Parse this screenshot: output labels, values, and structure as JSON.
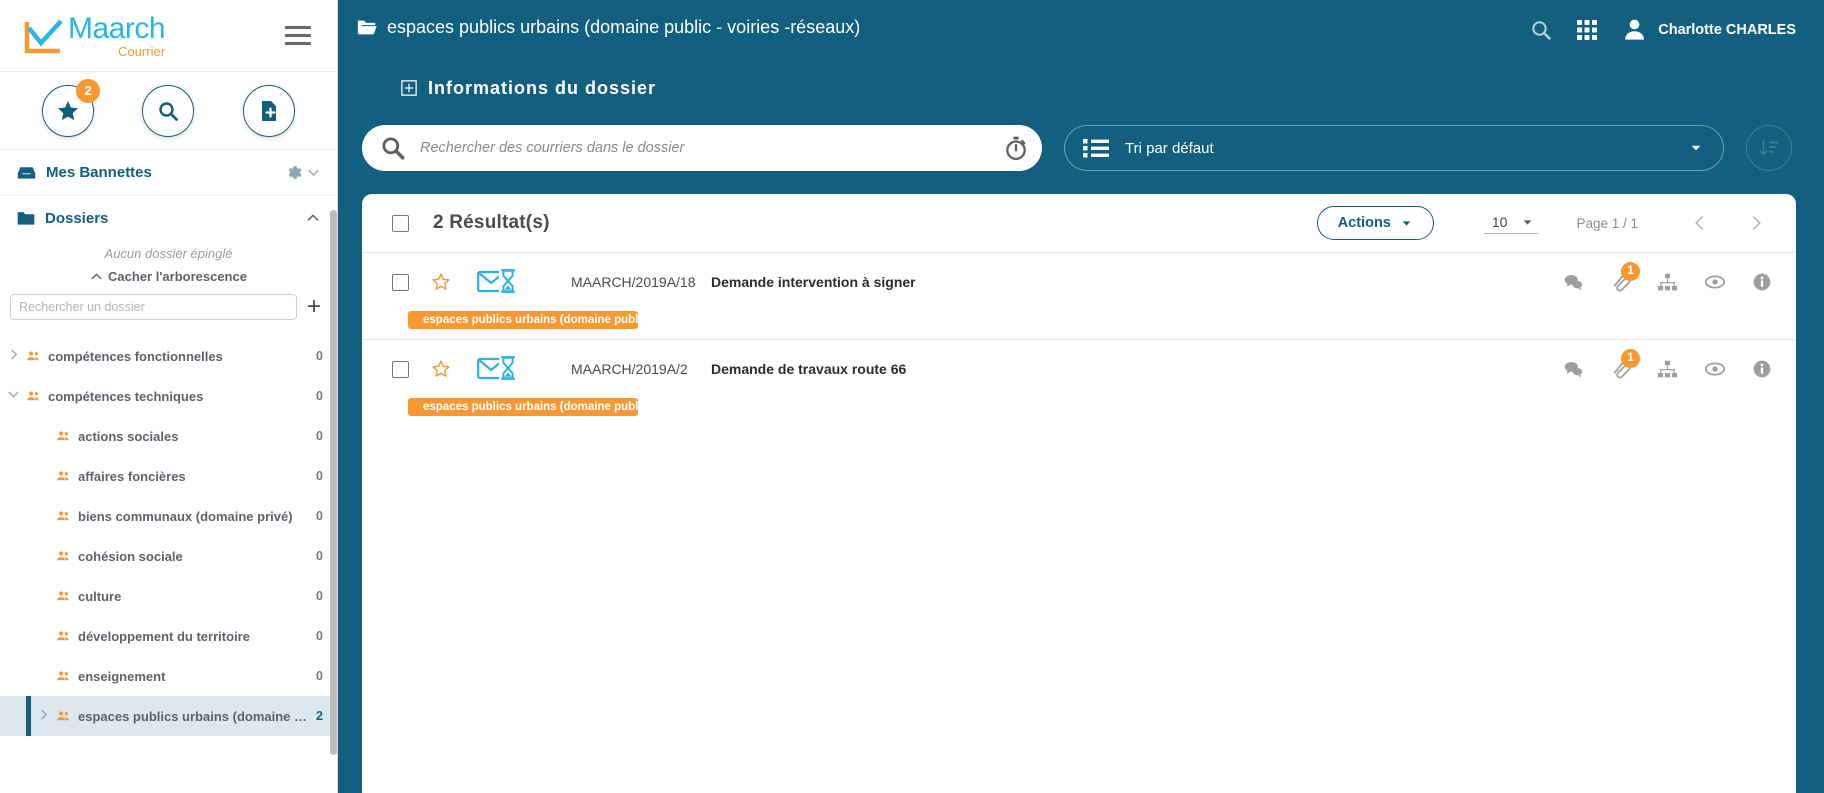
{
  "brand": {
    "name": "Maarch",
    "product": "Courrier",
    "logo_blue": "#29b5e8",
    "logo_orange": "#f99830",
    "primary": "#135f7f",
    "accent": "#f99830"
  },
  "sidebar": {
    "quick_actions": [
      {
        "name": "favorites-button",
        "icon": "star-icon",
        "badge": "2"
      },
      {
        "name": "search-button",
        "icon": "search-icon",
        "badge": ""
      },
      {
        "name": "new-document-button",
        "icon": "document-add-icon",
        "badge": ""
      }
    ],
    "baskets": {
      "label": "Mes Bannettes",
      "icon": "inbox-icon",
      "settings_icon": "gear-icon",
      "chevron": "chevron-down-icon"
    },
    "folders": {
      "label": "Dossiers",
      "icon": "folder-icon",
      "chevron": "chevron-up-icon"
    },
    "pinned_empty": "Aucun dossier épinglé",
    "hide_tree": "Cacher l'arborescence",
    "tree_search_placeholder": "Rechercher un dossier",
    "tree_search_value": "",
    "add_folder_label": "+",
    "tree": [
      {
        "label": "compétences fonctionnelles",
        "count": "0",
        "depth": 0,
        "caret": "right",
        "selected": false
      },
      {
        "label": "compétences techniques",
        "count": "0",
        "depth": 0,
        "caret": "down",
        "selected": false
      },
      {
        "label": "actions sociales",
        "count": "0",
        "depth": 1,
        "caret": "",
        "selected": false
      },
      {
        "label": "affaires foncières",
        "count": "0",
        "depth": 1,
        "caret": "",
        "selected": false
      },
      {
        "label": "biens communaux (domaine privé)",
        "count": "0",
        "depth": 1,
        "caret": "",
        "selected": false
      },
      {
        "label": "cohésion sociale",
        "count": "0",
        "depth": 1,
        "caret": "",
        "selected": false
      },
      {
        "label": "culture",
        "count": "0",
        "depth": 1,
        "caret": "",
        "selected": false
      },
      {
        "label": "développement du territoire",
        "count": "0",
        "depth": 1,
        "caret": "",
        "selected": false
      },
      {
        "label": "enseignement",
        "count": "0",
        "depth": 1,
        "caret": "",
        "selected": false
      },
      {
        "label": "espaces publics urbains (domaine pu…",
        "count": "2",
        "depth": 1,
        "caret": "right",
        "selected": true
      }
    ]
  },
  "header": {
    "breadcrumb": "espaces publics urbains (domaine public - voiries -réseaux)",
    "breadcrumb_icon": "folder-open-icon",
    "folder_info": "Informations du dossier",
    "folder_info_icon": "plus-box-icon",
    "user_name": "Charlotte CHARLES",
    "search_icon": "search-icon",
    "apps_icon": "grid-apps-icon",
    "avatar_icon": "user-avatar-icon"
  },
  "toolbar": {
    "search_placeholder": "Rechercher des courriers dans le dossier",
    "search_value": "",
    "search_icon": "search-icon",
    "chrono_icon": "stopwatch-icon",
    "sort_label": "Tri par défaut",
    "sort_list_icon": "list-bullet-icon",
    "sort_chevron": "chevron-down-icon",
    "sort_direction_icon": "sort-descending-icon"
  },
  "results": {
    "select_all_checkbox": false,
    "count_label": "2 Résultat(s)",
    "actions_label": "Actions",
    "actions_chevron": "chevron-down-icon",
    "page_size": "10",
    "page_size_chevron": "chevron-down-icon",
    "page_label": "Page 1 / 1",
    "prev_icon": "chevron-left-icon",
    "next_icon": "chevron-right-icon",
    "rows": [
      {
        "checked": false,
        "star_icon": "star-outline-icon",
        "status_icon": "mail-hourglass-icon",
        "chrono": "MAARCH/2019A/18",
        "subject": "Demande intervention à signer",
        "tag": "espaces publics urbains (domaine publ…",
        "tag_icon": "folder-icon",
        "icons": [
          {
            "name": "comments-icon",
            "badge": ""
          },
          {
            "name": "attachment-icon",
            "badge": "1"
          },
          {
            "name": "diffusion-list-icon",
            "badge": ""
          },
          {
            "name": "visa-circuit-icon",
            "badge": ""
          },
          {
            "name": "info-icon",
            "badge": ""
          }
        ]
      },
      {
        "checked": false,
        "star_icon": "star-outline-icon",
        "status_icon": "mail-hourglass-icon",
        "chrono": "MAARCH/2019A/2",
        "subject": "Demande de travaux route 66",
        "tag": "espaces publics urbains (domaine publ…",
        "tag_icon": "folder-icon",
        "icons": [
          {
            "name": "comments-icon",
            "badge": ""
          },
          {
            "name": "attachment-icon",
            "badge": "1"
          },
          {
            "name": "diffusion-list-icon",
            "badge": ""
          },
          {
            "name": "visa-circuit-icon",
            "badge": ""
          },
          {
            "name": "info-icon",
            "badge": ""
          }
        ]
      }
    ]
  }
}
